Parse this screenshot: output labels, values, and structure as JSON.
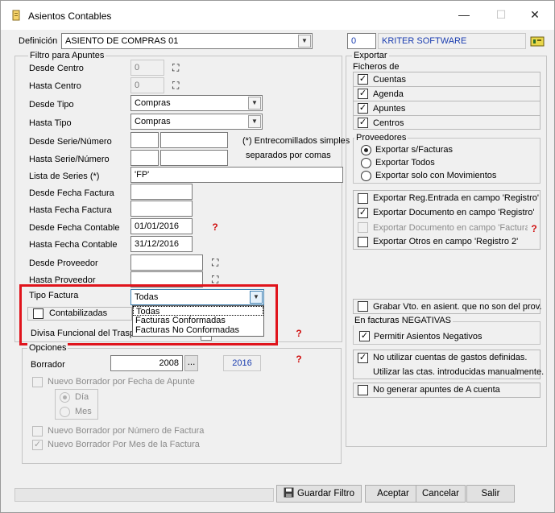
{
  "window": {
    "title": "Asientos Contables",
    "minimize": "—",
    "maximize": "☐",
    "close": "✕"
  },
  "definicion": {
    "label": "Definición",
    "value": "ASIENTO DE COMPRAS 01"
  },
  "company": {
    "code": "0",
    "name": "KRITER SOFTWARE"
  },
  "filtro": {
    "title": "Filtro para Apuntes",
    "desde_centro": {
      "label": "Desde Centro",
      "value": "0"
    },
    "hasta_centro": {
      "label": "Hasta Centro",
      "value": "0"
    },
    "desde_tipo": {
      "label": "Desde Tipo",
      "value": "Compras"
    },
    "hasta_tipo": {
      "label": "Hasta Tipo",
      "value": "Compras"
    },
    "desde_serie": {
      "label": "Desde Serie/Número",
      "serie": "",
      "numero": ""
    },
    "hasta_serie": {
      "label": "Hasta Serie/Número",
      "serie": "",
      "numero": ""
    },
    "note_line1": "(*) Entrecomillados simples",
    "note_line2": "separados por comas",
    "lista_series": {
      "label": "Lista de Series (*)",
      "value": "'FP'"
    },
    "desde_fecha_factura": {
      "label": "Desde Fecha Factura",
      "value": ""
    },
    "hasta_fecha_factura": {
      "label": "Hasta Fecha Factura",
      "value": ""
    },
    "desde_fecha_contable": {
      "label": "Desde Fecha Contable",
      "value": "01/01/2016"
    },
    "hasta_fecha_contable": {
      "label": "Hasta Fecha Contable",
      "value": "31/12/2016"
    },
    "desde_proveedor": {
      "label": "Desde Proveedor",
      "value": ""
    },
    "hasta_proveedor": {
      "label": "Hasta Proveedor",
      "value": ""
    },
    "tipo_factura": {
      "label": "Tipo Factura",
      "value": "Todas"
    },
    "tipo_factura_options": [
      "Todas",
      "Facturas Conformadas",
      "Facturas No Conformadas"
    ],
    "contabilizadas": "Contabilizadas",
    "divisa": {
      "label": "Divisa Funcional del Trasp",
      "value": ""
    }
  },
  "opciones": {
    "title": "Opciones",
    "borrador": {
      "label": "Borrador",
      "value": "2008",
      "dots": "...",
      "year": "2016"
    },
    "nuevo_fecha_apunte": "Nuevo Borrador por Fecha de Apunte",
    "dia": "Día",
    "mes": "Mes",
    "nuevo_numero_factura": "Nuevo Borrador por Número de Factura",
    "nuevo_mes_factura": "Nuevo Borrador Por Mes de la Factura"
  },
  "exportar": {
    "title": "Exportar",
    "ficheros_title": "Ficheros de",
    "ficheros": [
      {
        "label": "Cuentas",
        "checked": true
      },
      {
        "label": "Agenda",
        "checked": true
      },
      {
        "label": "Apuntes",
        "checked": true
      },
      {
        "label": "Centros",
        "checked": true
      }
    ],
    "proveedores_title": "Proveedores",
    "proveedores": [
      {
        "label": "Exportar s/Facturas",
        "selected": true
      },
      {
        "label": "Exportar Todos",
        "selected": false
      },
      {
        "label": "Exportar solo con Movimientos",
        "selected": false
      }
    ],
    "reg_entrada": "Exportar Reg.Entrada en campo 'Registro'",
    "documento": "Exportar Documento en campo 'Registro'",
    "documento_factura": "Exportar Documento en campo 'Factura",
    "otros": "Exportar Otros en campo 'Registro 2'",
    "grabar_vto": "Grabar Vto. en asient. que no son del prov.",
    "negativas_title": "En facturas NEGATIVAS",
    "permitir_negativos": "Permitir Asientos Negativos",
    "no_utilizar_line1": "No utilizar cuentas de gastos definidas.",
    "no_utilizar_line2": "Utilizar las ctas. introducidas manualmente.",
    "no_generar": "No generar apuntes de A cuenta"
  },
  "buttons": {
    "guardar": "Guardar Filtro",
    "aceptar": "Aceptar",
    "cancelar": "Cancelar",
    "salir": "Salir"
  },
  "colors": {
    "highlight": "#e0141c",
    "accent_text": "#1a3db0"
  }
}
